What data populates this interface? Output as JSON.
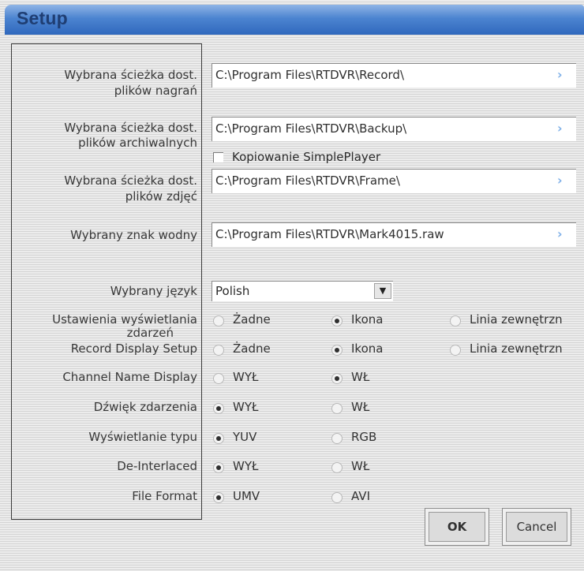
{
  "window": {
    "title": "Setup"
  },
  "paths": {
    "record": {
      "label_line1": "Wybrana ścieżka dost.",
      "label_line2": "plików nagrań",
      "value": "C:\\Program Files\\RTDVR\\Record\\",
      "browse": "›"
    },
    "backup": {
      "label_line1": "Wybrana ścieżka dost.",
      "label_line2": "plików archiwalnych",
      "value": "C:\\Program Files\\RTDVR\\Backup\\",
      "browse": "›"
    },
    "frame": {
      "label_line1": "Wybrana ścieżka dost.",
      "label_line2": "plików zdjęć",
      "value": "C:\\Program Files\\RTDVR\\Frame\\",
      "browse": "›"
    },
    "watermark": {
      "label": "Wybrany znak wodny",
      "value": "C:\\Program Files\\RTDVR\\Mark4015.raw",
      "browse": "›"
    }
  },
  "copy_simpleplayer": {
    "label": "Kopiowanie SimplePlayer",
    "checked": false
  },
  "language": {
    "label": "Wybrany język",
    "value": "Polish",
    "arrow": "▼"
  },
  "options": [
    {
      "id": "event-display",
      "label_line1": "Ustawienia wyświetlania",
      "label_line2": "zdarzeń",
      "choices": [
        "Żadne",
        "Ikona",
        "Linia zewnętrzn"
      ],
      "selected": 1
    },
    {
      "id": "record-display",
      "label_line1": "Record Display Setup",
      "choices": [
        "Żadne",
        "Ikona",
        "Linia zewnętrzn"
      ],
      "selected": 1
    },
    {
      "id": "channel-name",
      "label_line1": "Channel Name Display",
      "choices": [
        "WYŁ",
        "WŁ"
      ],
      "selected": 1
    },
    {
      "id": "event-sound",
      "label_line1": "Dźwięk zdarzenia",
      "choices": [
        "WYŁ",
        "WŁ"
      ],
      "selected": 0
    },
    {
      "id": "display-type",
      "label_line1": "Wyświetlanie typu",
      "choices": [
        "YUV",
        "RGB"
      ],
      "selected": 0
    },
    {
      "id": "deinterlaced",
      "label_line1": "De-Interlaced",
      "choices": [
        "WYŁ",
        "WŁ"
      ],
      "selected": 0
    },
    {
      "id": "file-format",
      "label_line1": "File Format",
      "choices": [
        "UMV",
        "AVI"
      ],
      "selected": 0
    }
  ],
  "buttons": {
    "ok": "OK",
    "cancel": "Cancel"
  },
  "colors": {
    "title_gradient_top": "#8fb4e6",
    "title_gradient_bottom": "#2f68bd",
    "browse_arrow": "#7fb0e8"
  }
}
